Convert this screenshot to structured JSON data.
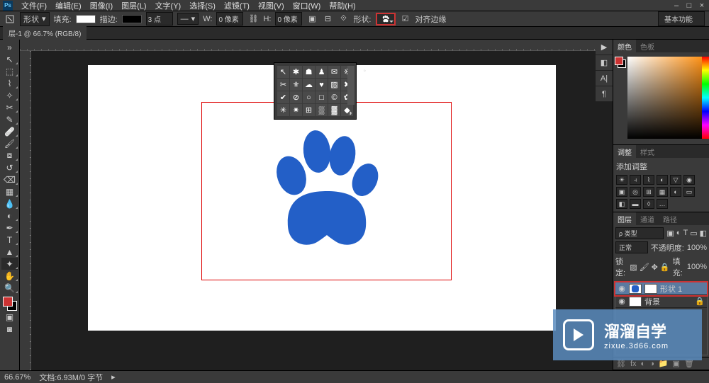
{
  "menu": {
    "file": "文件(F)",
    "edit": "编辑(E)",
    "image": "图像(I)",
    "layer": "图层(L)",
    "type": "文字(Y)",
    "select": "选择(S)",
    "filter": "滤镜(T)",
    "view": "视图(V)",
    "window": "窗口(W)",
    "help": "帮助(H)"
  },
  "options": {
    "shape_mode": "形状",
    "fill": "填充:",
    "stroke": "描边:",
    "stroke_width": "3 点",
    "w_label": "W:",
    "w_value": "0 像素",
    "h_label": "H:",
    "h_value": "0 像素",
    "shape_label": "形状:",
    "align": "对齐边缘",
    "basic": "基本功能"
  },
  "doc": {
    "tab": "层-1 @ 66.7% (RGB/8)"
  },
  "panels": {
    "color": "颜色",
    "swatches": "色板",
    "adjustments": "调整",
    "styles": "样式",
    "add_adjust": "添加调整",
    "layers": "图层",
    "channels": "通道",
    "paths": "路径",
    "kind": "ρ 类型",
    "blend": "正常",
    "opacity_label": "不透明度:",
    "opacity": "100%",
    "lock_label": "锁定:",
    "fill_label": "填充:",
    "fill_pct": "100%",
    "layer1": "形状 1",
    "bg": "背景"
  },
  "status": {
    "zoom": "66.67%",
    "doc": "文档:6.93M/0 字节"
  },
  "watermark": {
    "main": "溜溜自学",
    "sub": "zixue.3d66.com"
  },
  "icons": {
    "arrow": "↔",
    "minimize": "–",
    "maximize": "□",
    "close": "×",
    "play": "▶",
    "menu": "▸",
    "eye": "👁",
    "lock": "🔒",
    "trash": "🗑",
    "link": "⛓",
    "new": "▣",
    "fx": "fx",
    "mask": "◐",
    "group": "📁",
    "adj": "◑"
  }
}
